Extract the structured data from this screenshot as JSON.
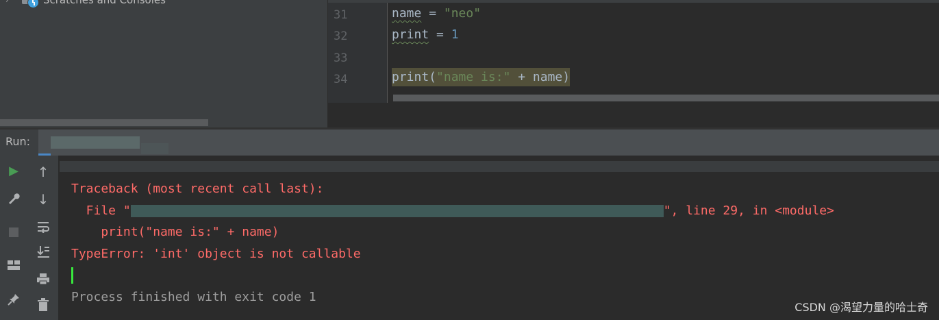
{
  "project": {
    "tree_item_label": "Scratches and Consoles",
    "tree_item_icon": "scratches-clock-icon"
  },
  "editor": {
    "lines": [
      {
        "num": "31",
        "tokens": [
          "name",
          " = ",
          "\"neo\""
        ]
      },
      {
        "num": "32",
        "tokens": [
          "print",
          " = ",
          "1"
        ]
      },
      {
        "num": "33",
        "tokens": []
      },
      {
        "num": "34",
        "tokens": [
          "print(",
          "\"name is:\"",
          " + name)"
        ]
      }
    ]
  },
  "run": {
    "label": "Run:",
    "toolbar_left": [
      "run-icon",
      "wrench-icon",
      "stop-icon",
      "layout-icon",
      "pin-icon"
    ],
    "toolbar_right": [
      "up-arrow-icon",
      "down-arrow-icon",
      "soft-wrap-icon",
      "scroll-to-end-icon",
      "print-icon",
      "trash-icon"
    ]
  },
  "console": {
    "line1": "Traceback (most recent call last):",
    "line2_prefix": "  File \"",
    "line2_suffix": "\", line 29, in <module>",
    "line3": "    print(\"name is:\" + name)",
    "line4": "TypeError: 'int' object is not callable",
    "line6": "Process finished with exit code 1"
  },
  "watermark": "CSDN @渴望力量的哈士奇",
  "colors": {
    "error_red": "#ff6b68",
    "caret_green": "#38e83d",
    "string_green": "#6a8759",
    "number_blue": "#6897bb"
  }
}
